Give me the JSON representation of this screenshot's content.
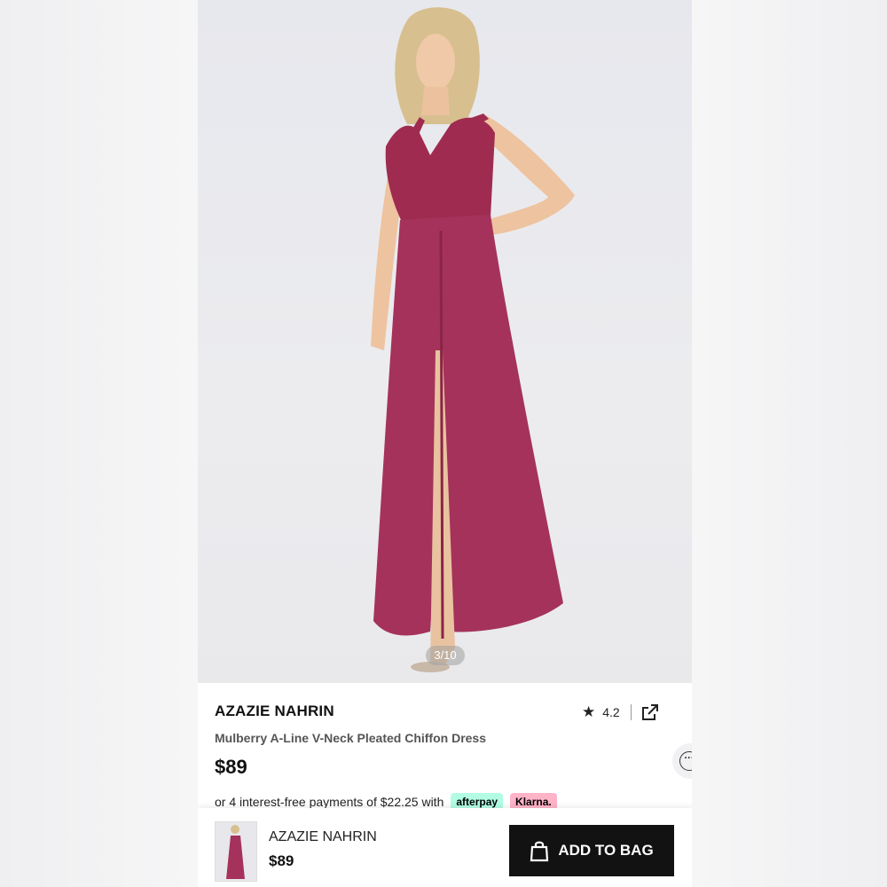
{
  "gallery": {
    "counter": "3/10"
  },
  "product": {
    "brand": "AZAZIE NAHRIN",
    "title": "Mulberry A-Line V-Neck Pleated Chiffon Dress",
    "price": "$89",
    "rating": "4.2",
    "installments_text": "or 4 interest-free payments of $22.25 with",
    "afterpay_label": "afterpay",
    "klarna_label": "Klarna."
  },
  "bottom_bar": {
    "brand": "AZAZIE NAHRIN",
    "price": "$89",
    "add_to_bag_label": "ADD TO BAG"
  },
  "icons": [
    "star-icon",
    "share-icon",
    "more-icon",
    "bag-icon"
  ],
  "colors": {
    "dress": "#a12e52",
    "button": "#121212",
    "afterpay": "#b2fce4",
    "klarna": "#ffb3c7"
  }
}
